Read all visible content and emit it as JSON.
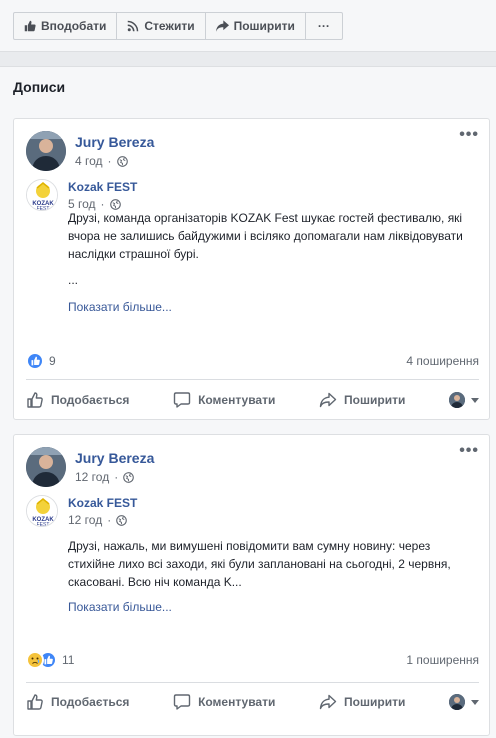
{
  "page_actions": {
    "like_label": "Вподобати",
    "follow_label": "Стежити",
    "share_label": "Поширити",
    "more_label": "···"
  },
  "section": {
    "title": "Дописи"
  },
  "posts": [
    {
      "author": "Jury Bereza",
      "time": "4 год",
      "shared_page": "Kozak FEST",
      "shared_time": "5 год",
      "text": "Друзі, команда організаторів KOZAK Fest шукає гостей фестивалю, які вчора не залишись байдужими і всіляко допомагали нам ліквідовувати наслідки страшної бурі.",
      "ellipsis": "...",
      "see_more": "Показати більше...",
      "reaction_count": "9",
      "shares": "4 поширення",
      "actions": {
        "like": "Подобається",
        "comment": "Коментувати",
        "share": "Поширити"
      }
    },
    {
      "author": "Jury Bereza",
      "time": "12 год",
      "shared_page": "Kozak FEST",
      "shared_time": "12 год",
      "text": "Друзі, нажаль, ми вимушені повідомити вам сумну новину: через стихійне лихо всі заходи, які були заплановані на сьогодні, 2 червня, скасовані. Всю ніч команда K...",
      "see_more": "Показати більше...",
      "reaction_count": "11",
      "shares": "1 поширення",
      "actions": {
        "like": "Подобається",
        "comment": "Коментувати",
        "share": "Поширити"
      }
    }
  ],
  "icons": {
    "like": "thumbs-up-icon",
    "follow": "rss-icon",
    "share": "share-arrow-icon",
    "globe": "globe-icon",
    "comment": "comment-bubble-icon",
    "more": "more-dots-icon"
  },
  "colors": {
    "link": "#365899",
    "like_reaction": "#3f86f7",
    "sad_reaction": "#f5c33b",
    "background": "#e9ebee"
  }
}
